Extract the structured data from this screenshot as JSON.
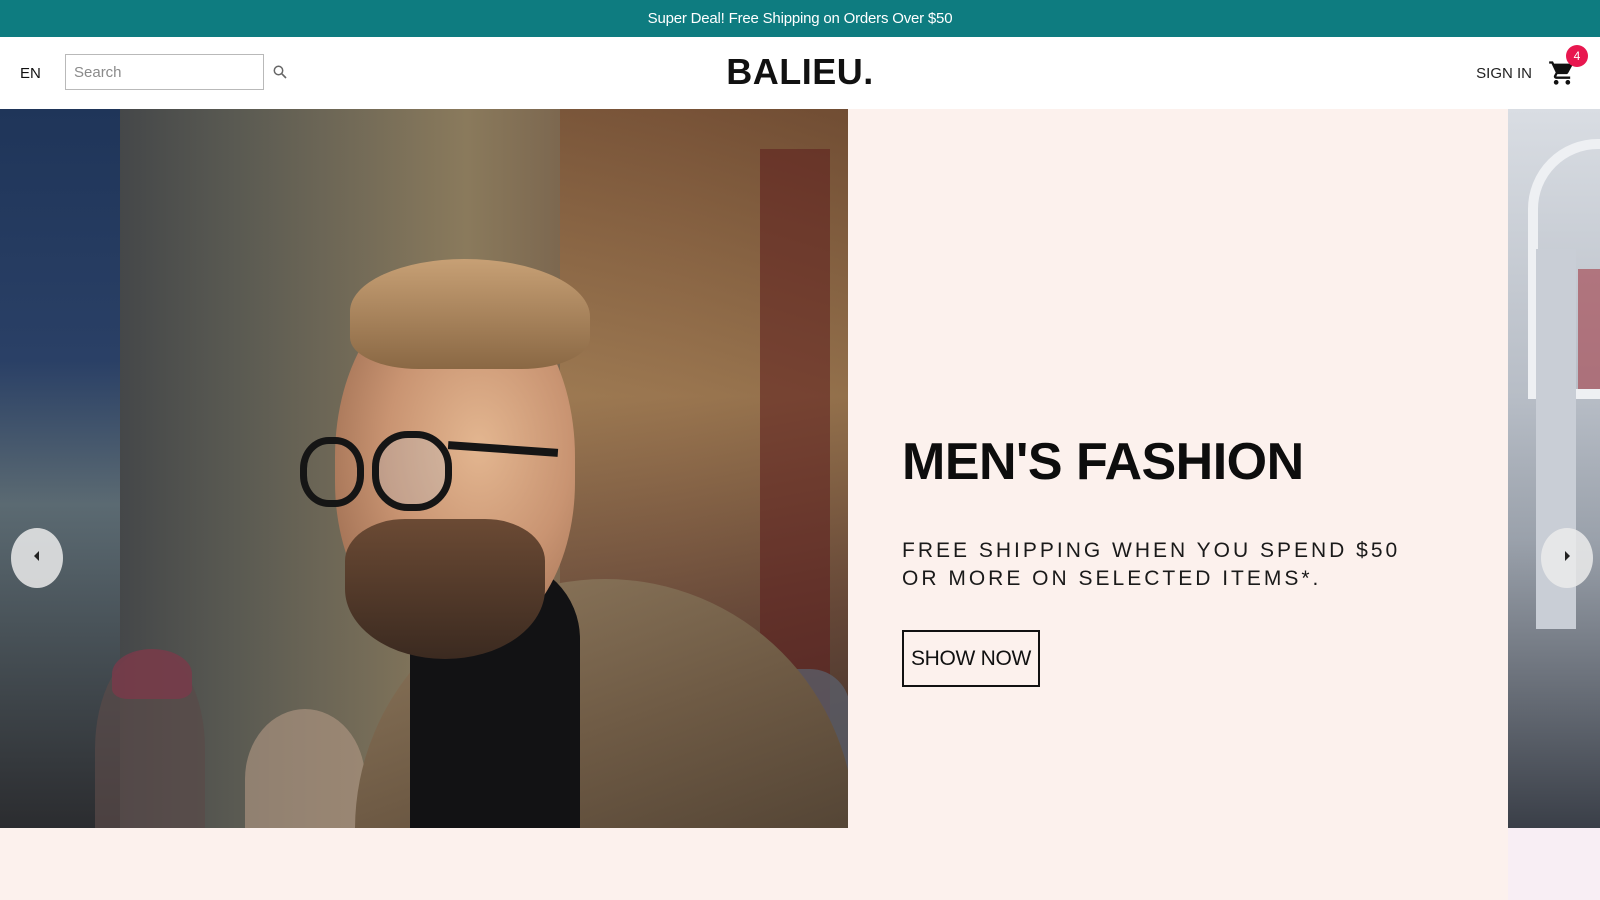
{
  "announcement": {
    "text": "Super Deal! Free Shipping on Orders Over $50"
  },
  "header": {
    "language": "EN",
    "search": {
      "placeholder": "Search",
      "value": ""
    },
    "logo": "BALIEU.",
    "sign_in": "SIGN IN",
    "cart": {
      "count": "4"
    }
  },
  "slider": {
    "current_slide": {
      "title": "MEN'S FASHION",
      "description": "FREE SHIPPING WHEN YOU SPEND $50 OR MORE ON SELECTED ITEMS*.",
      "button_label": "SHOW NOW"
    },
    "icons": {
      "prev": "chevron-left-icon",
      "next": "chevron-right-icon"
    }
  },
  "colors": {
    "announcement_bg": "#0e7c80",
    "slide_bg": "#fcf1ed",
    "cart_badge": "#e8174f"
  }
}
